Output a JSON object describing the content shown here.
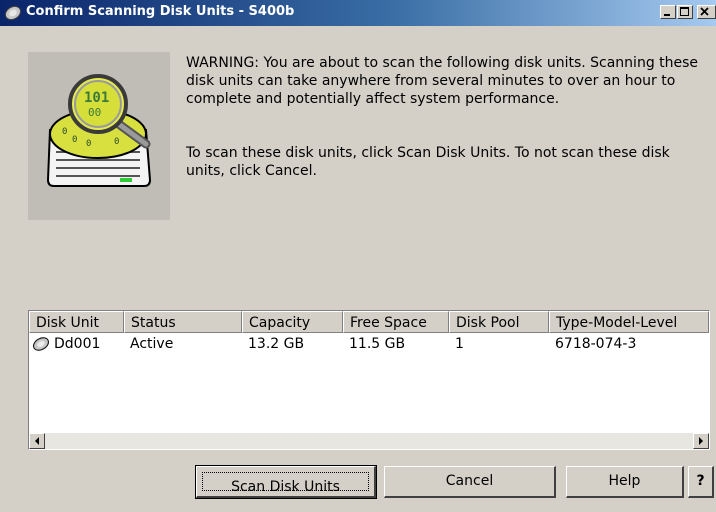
{
  "window": {
    "title": "Confirm Scanning Disk Units - S400b",
    "icon": "disk-icon",
    "controls": [
      "minimize-icon",
      "maximize-icon",
      "close-icon"
    ]
  },
  "message": {
    "warning": "WARNING: You are about to scan the following disk units. Scanning these disk units can take anywhere from several minutes to over an hour to complete and potentially affect system performance.",
    "instruction": "To scan these disk units, click Scan Disk Units.   To not scan these disk units, click Cancel."
  },
  "illustration": "disk-scan-icon",
  "table": {
    "columns": [
      "Disk Unit",
      "Status",
      "Capacity",
      "Free Space",
      "Disk Pool",
      "Type-Model-Level"
    ],
    "rows": [
      {
        "icon": "disk-unit-icon",
        "disk_unit": "Dd001",
        "status": "Active",
        "capacity": "13.2 GB",
        "free_space": "11.5 GB",
        "disk_pool": "1",
        "tml": "6718-074-3"
      }
    ]
  },
  "buttons": {
    "scan": "Scan Disk Units",
    "cancel": "Cancel",
    "help": "Help",
    "whats_this": "?"
  },
  "colors": {
    "title_start": "#0a246a",
    "title_end": "#a6caf0",
    "face": "#d4d0c8"
  }
}
